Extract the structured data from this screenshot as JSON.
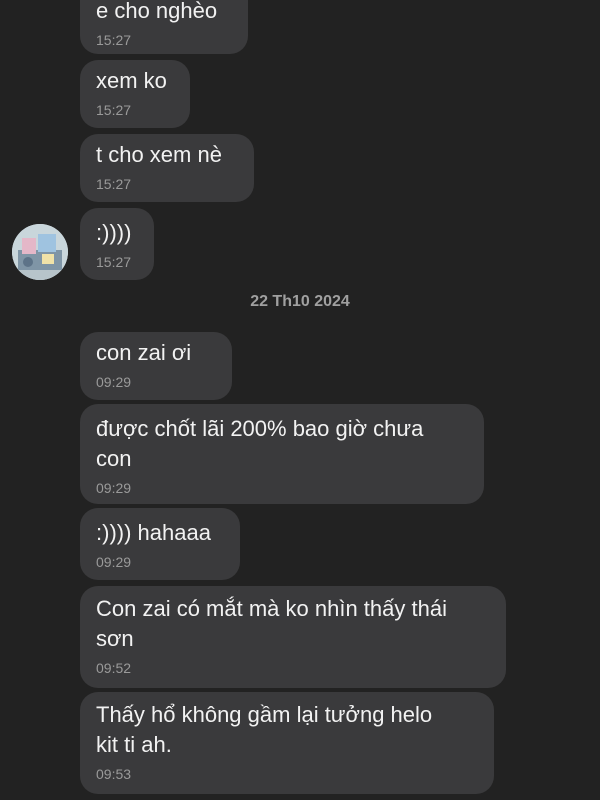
{
  "messages": [
    {
      "text": "e cho nghèo",
      "time": "15:27"
    },
    {
      "text": "xem ko",
      "time": "15:27"
    },
    {
      "text": "t cho xem nè",
      "time": "15:27"
    },
    {
      "text": ":))))",
      "time": "15:27"
    },
    {
      "text": "con zai ơi",
      "time": "09:29"
    },
    {
      "text": "được chốt lãi 200% bao giờ chưa\ncon",
      "time": "09:29"
    },
    {
      "text": ":)))) hahaaa",
      "time": "09:29"
    },
    {
      "text": "Con zai có mắt mà ko nhìn thấy thái\nsơn",
      "time": "09:52"
    },
    {
      "text": "Thấy hổ không gầm lại tưởng helo\nkit ti ah.",
      "time": "09:53"
    }
  ],
  "date_separator": "22 Th10 2024",
  "colors": {
    "background": "#222222",
    "bubble": "#3a3a3c",
    "text": "#f2f2f2",
    "timestamp": "#9a9a9a"
  },
  "avatar": {
    "icon": "user-avatar-image"
  }
}
